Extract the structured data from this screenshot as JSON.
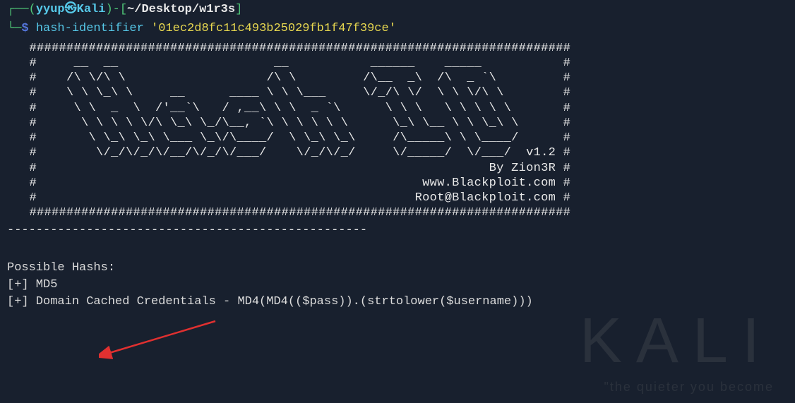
{
  "prompt": {
    "open_paren": "┌──(",
    "user": "yyup",
    "icon": "㉿",
    "host": "Kali",
    "close_paren": ")-[",
    "path": "~/Desktop/w1r3s",
    "end_bracket": "]",
    "line2_prefix": "└─",
    "dollar": "$",
    "command": "hash-identifier",
    "argument": "'01ec2d8fc11c493b25029fb1f47f39ce'"
  },
  "banner": "   #########################################################################\n   #     __  __                     __           ______    _____           #\n   #    /\\ \\/\\ \\                   /\\ \\         /\\__  _\\  /\\  _ `\\         #\n   #    \\ \\ \\_\\ \\     __      ____ \\ \\ \\___     \\/_/\\ \\/  \\ \\ \\/\\ \\        #\n   #     \\ \\  _  \\  /'__`\\   / ,__\\ \\ \\  _ `\\      \\ \\ \\   \\ \\ \\ \\ \\       #\n   #      \\ \\ \\ \\ \\/\\ \\_\\ \\_/\\__, `\\ \\ \\ \\ \\ \\      \\_\\ \\__ \\ \\ \\_\\ \\      #\n   #       \\ \\_\\ \\_\\ \\___ \\_\\/\\____/  \\ \\_\\ \\_\\     /\\_____\\ \\ \\____/      #\n   #        \\/_/\\/_/\\/__/\\/_/\\/___/    \\/_/\\/_/     \\/_____/  \\/___/  v1.2 #\n   #                                                             By Zion3R #\n   #                                                    www.Blackploit.com #\n   #                                                   Root@Blackploit.com #\n   #########################################################################",
  "separator": "--------------------------------------------------",
  "results": {
    "label": "Possible Hashs:",
    "items": [
      "[+] MD5",
      "[+] Domain Cached Credentials - MD4(MD4(($pass)).(strtolower($username)))"
    ]
  },
  "watermark": {
    "big": "KALI",
    "small": "\"the quieter you become"
  }
}
